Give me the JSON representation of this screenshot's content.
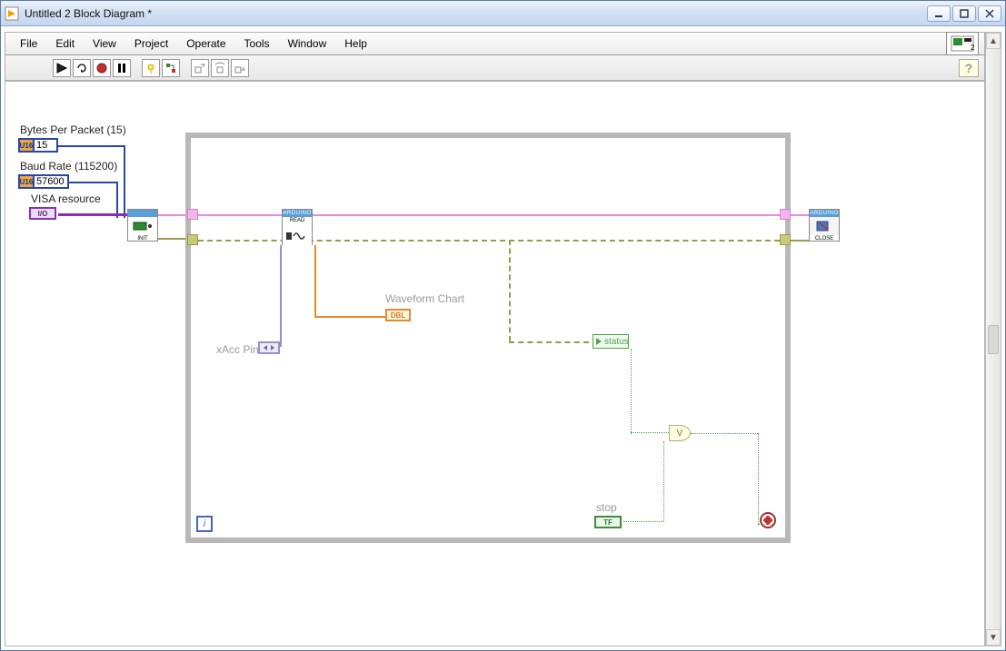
{
  "window": {
    "title": "Untitled 2 Block Diagram *"
  },
  "menu": {
    "file": "File",
    "edit": "Edit",
    "view": "View",
    "project": "Project",
    "operate": "Operate",
    "tools": "Tools",
    "window": "Window",
    "help": "Help"
  },
  "toolbar": {
    "help_glyph": "?"
  },
  "panel_badge": "2",
  "labels": {
    "bytes_per_packet": "Bytes Per Packet (15)",
    "baud_rate": "Baud Rate (115200)",
    "visa_resource": "VISA resource",
    "xacc_pin": "xAcc Pin",
    "waveform_chart": "Waveform Chart",
    "status": "status",
    "stop": "stop"
  },
  "values": {
    "bytes_per_packet": "15",
    "baud_rate": "57600",
    "visa_io": "I/O",
    "dbl_tag": "DBL",
    "tf_tag": "TF",
    "u16_tag": "U16",
    "or_glyph": "V",
    "loop_i": "i"
  },
  "subvi": {
    "arduino_hdr": "ARDUINO",
    "init": "INIT",
    "read": "READ",
    "close": "CLOSE"
  }
}
